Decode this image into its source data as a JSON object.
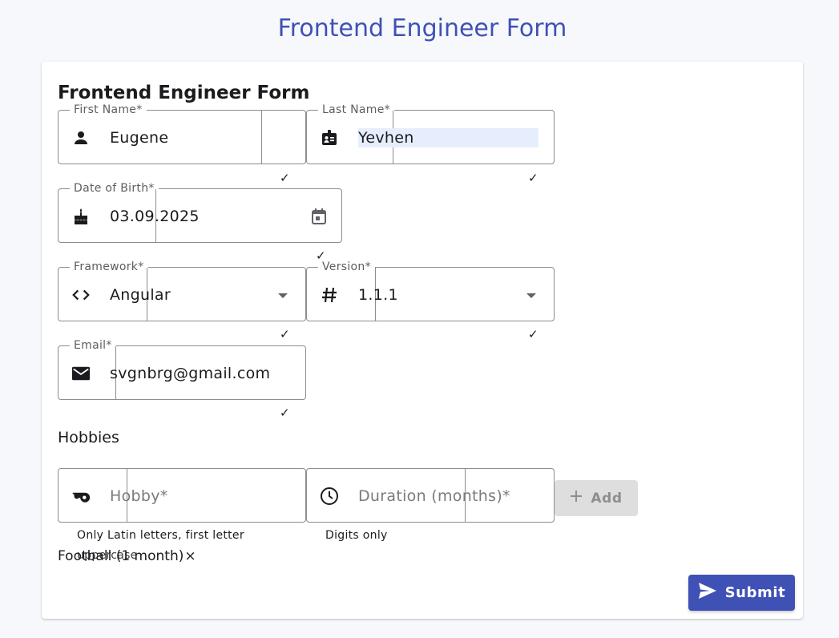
{
  "page": {
    "title": "Frontend Engineer Form"
  },
  "form": {
    "heading": "Frontend Engineer Form",
    "first_name": {
      "label": "First Name*",
      "value": "Eugene",
      "icon": "person-icon",
      "valid_mark": "✓"
    },
    "last_name": {
      "label": "Last Name*",
      "value": "Yevhen",
      "icon": "badge-icon",
      "valid_mark": "✓"
    },
    "date_of_birth": {
      "label": "Date of Birth*",
      "value": "03.09.2025",
      "icon": "cake-icon",
      "trailing_icon": "calendar-icon",
      "valid_mark": "✓"
    },
    "framework": {
      "label": "Framework*",
      "value": "Angular",
      "icon": "code-icon",
      "trailing_icon": "dropdown-arrow-icon",
      "valid_mark": "✓"
    },
    "version": {
      "label": "Version*",
      "value": "1.1.1",
      "icon": "hash-icon",
      "trailing_icon": "dropdown-arrow-icon",
      "valid_mark": "✓"
    },
    "email": {
      "label": "Email*",
      "value": "svgnbrg@gmail.com",
      "icon": "mail-icon",
      "valid_mark": "✓"
    },
    "hobbies": {
      "section_label": "Hobbies",
      "hobby_input": {
        "placeholder": "Hobby*",
        "icon": "whistle-icon",
        "hint": "Only Latin letters, first letter",
        "hint_overflow": "uppercase"
      },
      "duration_input": {
        "placeholder": "Duration (months)*",
        "icon": "clock-icon",
        "hint": "Digits only"
      },
      "add_button": {
        "label": "Add",
        "icon": "plus-icon",
        "disabled": true
      },
      "items": [
        {
          "text": "Football (1 month)",
          "remove": "×"
        }
      ]
    },
    "submit_button": {
      "label": "Submit",
      "icon": "send-icon"
    }
  },
  "colors": {
    "primary": "#3f51b5",
    "border": "#8c8c92",
    "disabled_bg": "#dedede",
    "selection": "#e6eefd"
  }
}
